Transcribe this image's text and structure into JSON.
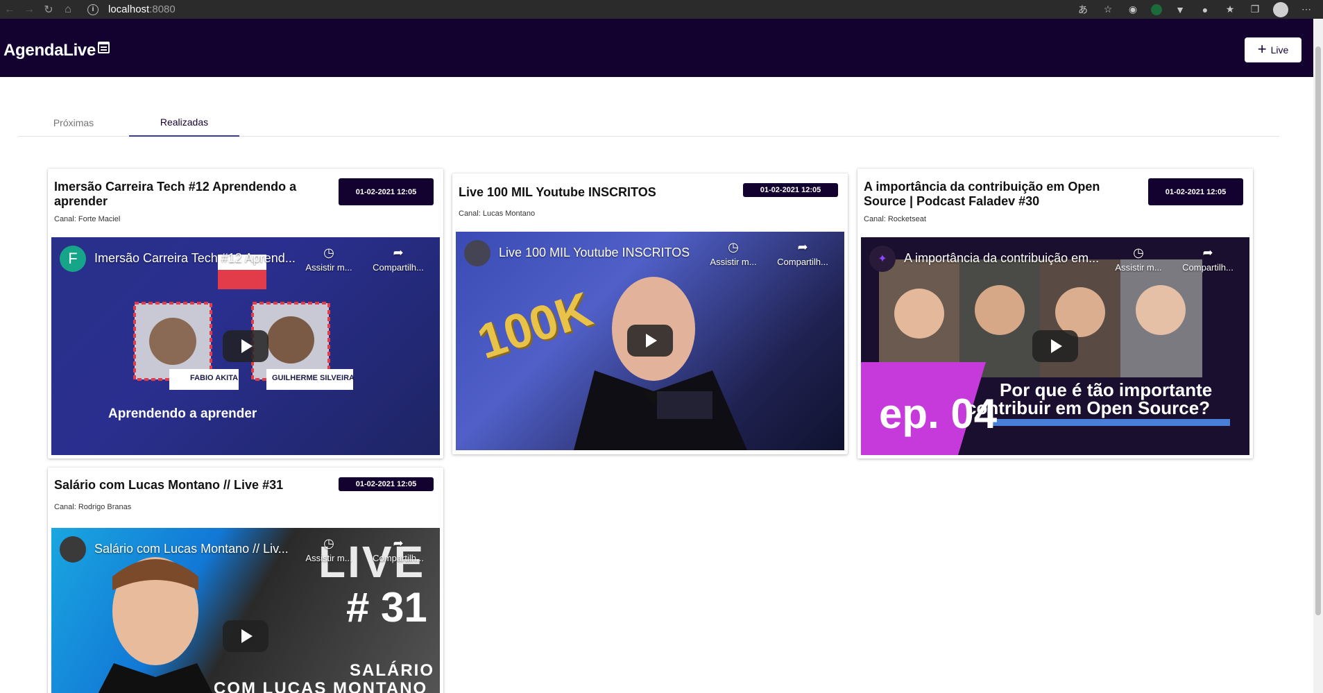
{
  "browser": {
    "url_host": "localhost",
    "url_port": ":8080"
  },
  "header": {
    "brand": "AgendaLive",
    "add_button_label": "Live"
  },
  "tabs": [
    {
      "label": "Próximas",
      "active": false
    },
    {
      "label": "Realizadas",
      "active": true
    }
  ],
  "cards": [
    {
      "title": "Imersão Carreira Tech #12 Aprendendo a aprender",
      "date": "01-02-2021 12:05",
      "channel": "Canal: Forte Maciel",
      "video_title": "Imersão Carreira Tech #12 Aprend...",
      "avatar_letter": "F",
      "watch_later": "Assistir m...",
      "share": "Compartilh...",
      "thumb_lines": [
        "Aprendendo a aprender",
        "FABIO AKITA",
        "GUILHERME SILVEIRA"
      ]
    },
    {
      "title": "Live 100 MIL Youtube INSCRITOS",
      "date": "01-02-2021 12:05",
      "channel": "Canal: Lucas Montano",
      "video_title": "Live 100 MIL Youtube INSCRITOS",
      "watch_later": "Assistir m...",
      "share": "Compartilh...",
      "thumb_lines": [
        "100K"
      ]
    },
    {
      "title": "A importância da contribuição em Open Source | Podcast Faladev #30",
      "date": "01-02-2021 12:05",
      "channel": "Canal: Rocketseat",
      "video_title": "A importância da contribuição em...",
      "watch_later": "Assistir m...",
      "share": "Compartilh...",
      "thumb_lines": [
        "ep. 04",
        "Por que é tão importante",
        "contribuir em Open Source?"
      ]
    },
    {
      "title": "Salário com Lucas Montano // Live #31",
      "date": "01-02-2021 12:05",
      "channel": "Canal: Rodrigo Branas",
      "video_title": "Salário com Lucas Montano // Liv...",
      "watch_later": "Assistir m...",
      "share": "Compartilh...",
      "thumb_lines": [
        "LIVE",
        "# 31",
        "SALÁRIO",
        "COM LUCAS MONTANO"
      ]
    }
  ]
}
